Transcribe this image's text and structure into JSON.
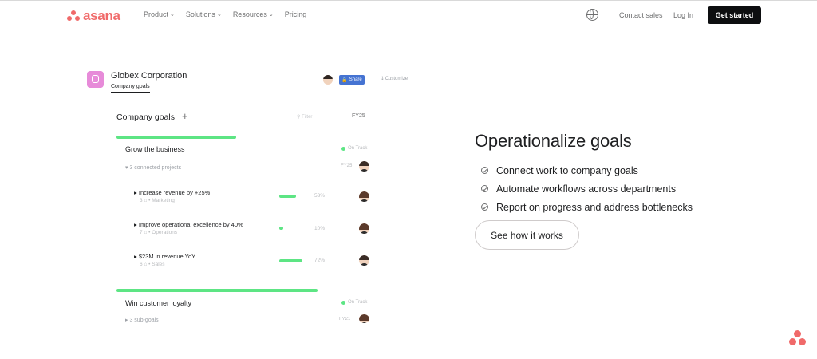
{
  "header": {
    "logo_text": "asana",
    "nav": [
      {
        "label": "Product"
      },
      {
        "label": "Solutions"
      },
      {
        "label": "Resources"
      },
      {
        "label": "Pricing"
      }
    ],
    "contact_sales": "Contact sales",
    "login": "Log In",
    "get_started": "Get started"
  },
  "mock": {
    "org_name": "Globex Corporation",
    "tab": "Company goals",
    "share": "Share",
    "customize": "Customize",
    "goals_title": "Company goals",
    "filter": "Filter",
    "period": "FY25",
    "goals": [
      {
        "name": "Grow the business",
        "status": "On Track",
        "sub": "3 connected projects",
        "fy": "FY25",
        "projects": [
          {
            "title": "Increase revenue by +25%",
            "meta_count": "3",
            "team": "Marketing",
            "percent": "53%",
            "progress": 0.53
          },
          {
            "title": "Improve operational excellence by 40%",
            "meta_count": "7",
            "team": "Operations",
            "percent": "10%",
            "progress": 0.1
          },
          {
            "title": "$23M in revenue YoY",
            "meta_count": "6",
            "team": "Sales",
            "percent": "72%",
            "progress": 0.72
          }
        ]
      },
      {
        "name": "Win customer loyalty",
        "status": "On Track",
        "sub": "3 sub-goals",
        "fy": "FY21"
      }
    ]
  },
  "hero": {
    "title": "Operationalize goals",
    "features": [
      "Connect work to company goals",
      "Automate workflows across departments",
      "Report on progress and address bottlenecks"
    ],
    "cta": "See how it works"
  },
  "colors": {
    "brand": "#f06a6a",
    "progress": "#5de584",
    "share_blue": "#4573d2"
  }
}
